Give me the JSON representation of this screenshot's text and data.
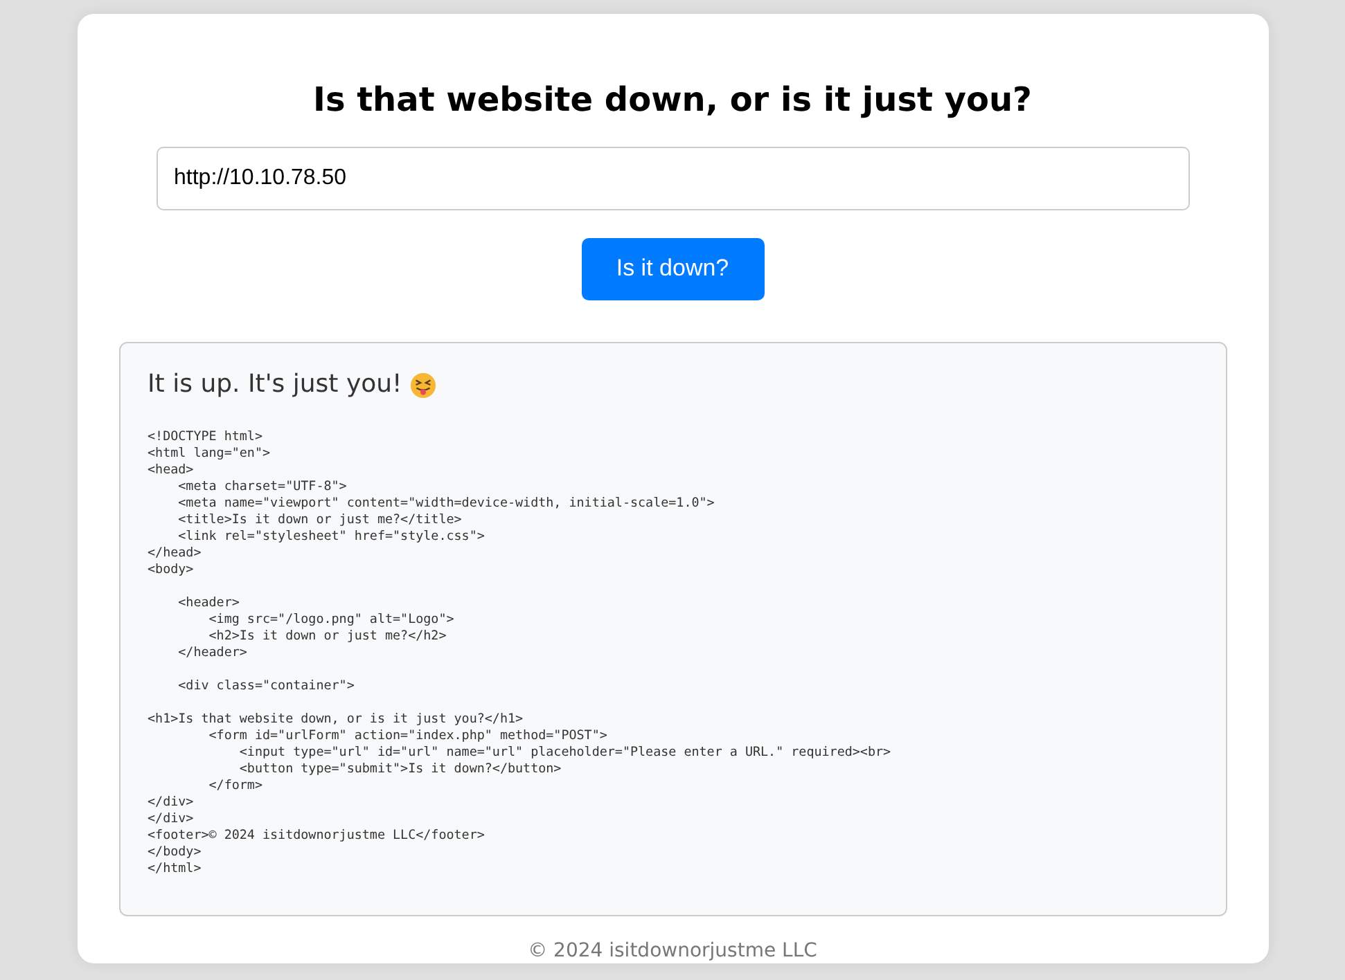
{
  "title": "Is that website down, or is it just you?",
  "url_field": {
    "value": "http://10.10.78.50"
  },
  "button": {
    "label": "Is it down?"
  },
  "result": {
    "message": "It is up. It's just you!",
    "source_code": "<!DOCTYPE html>\n<html lang=\"en\">\n<head>\n    <meta charset=\"UTF-8\">\n    <meta name=\"viewport\" content=\"width=device-width, initial-scale=1.0\">\n    <title>Is it down or just me?</title>\n    <link rel=\"stylesheet\" href=\"style.css\">\n</head>\n<body>\n\n    <header>\n        <img src=\"/logo.png\" alt=\"Logo\">\n        <h2>Is it down or just me?</h2>\n    </header>\n\n    <div class=\"container\">\n\n<h1>Is that website down, or is it just you?</h1>\n        <form id=\"urlForm\" action=\"index.php\" method=\"POST\">\n            <input type=\"url\" id=\"url\" name=\"url\" placeholder=\"Please enter a URL.\" required><br>\n            <button type=\"submit\">Is it down?</button>\n        </form>\n</div>\n</div>\n<footer>© 2024 isitdownorjustme LLC</footer>\n</body>\n</html>"
  },
  "footer": "© 2024 isitdownorjustme LLC"
}
